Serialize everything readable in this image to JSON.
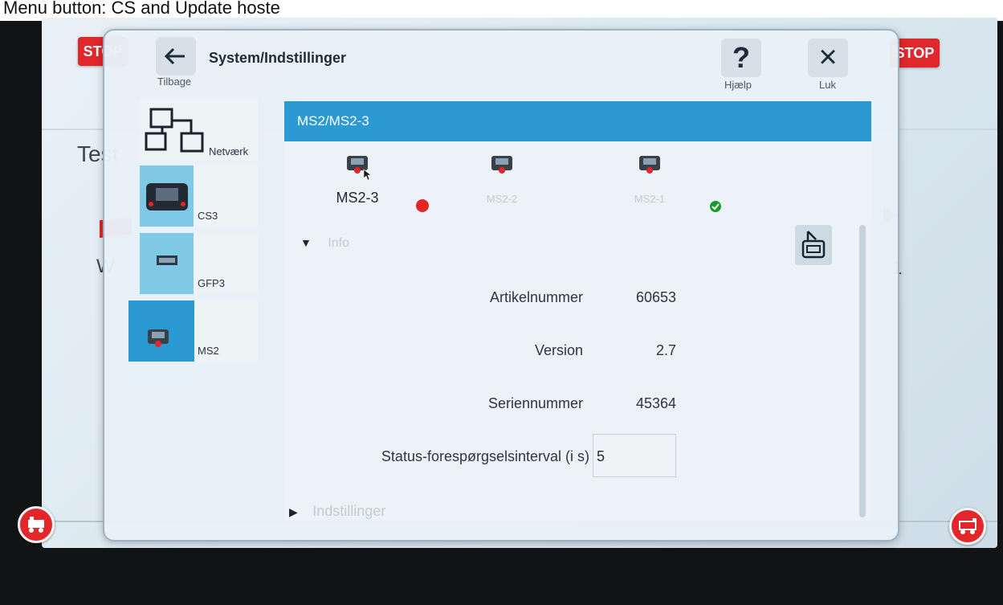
{
  "caption": "Menu button: CS and Update hoste",
  "stop_label": "STOP",
  "background": {
    "left_text": "Test",
    "left_small": "W",
    "right_number": "1"
  },
  "header": {
    "back_label": "Tilbage",
    "title": "System/Indstillinger",
    "help_glyph": "?",
    "help_label": "Hjælp",
    "close_glyph": "×",
    "close_label": "Luk"
  },
  "sidebar": {
    "items": [
      {
        "label": "Netværk",
        "icon": "network-icon"
      },
      {
        "label": "CS3",
        "icon": "cs3-device-icon"
      },
      {
        "label": "GFP3",
        "icon": "gfp3-chip-icon"
      },
      {
        "label": "MS2",
        "icon": "ms2-device-icon"
      }
    ]
  },
  "main": {
    "header_title": "MS2/MS2-3",
    "devices": [
      {
        "label": "MS2-3",
        "status": "red",
        "active": true
      },
      {
        "label": "MS2-2",
        "status": "none",
        "active": false
      },
      {
        "label": "MS2-1",
        "status": "green-check",
        "active": false
      }
    ],
    "info_section": "Info",
    "settings_section": "Indstillinger",
    "rows": [
      {
        "label": "Artikelnummer",
        "value": "60653"
      },
      {
        "label": "Version",
        "value": "2.7"
      },
      {
        "label": "Seriennummer",
        "value": "45364"
      }
    ],
    "interval_label": "Status-forespørgselsinterval (i s)",
    "interval_value": "5"
  },
  "colors": {
    "accent": "#2c9ad2",
    "stop": "#e0272b",
    "nav_highlight": "#7fc8e6",
    "status_red": "#e3262a",
    "status_green": "#1a9a2a"
  }
}
